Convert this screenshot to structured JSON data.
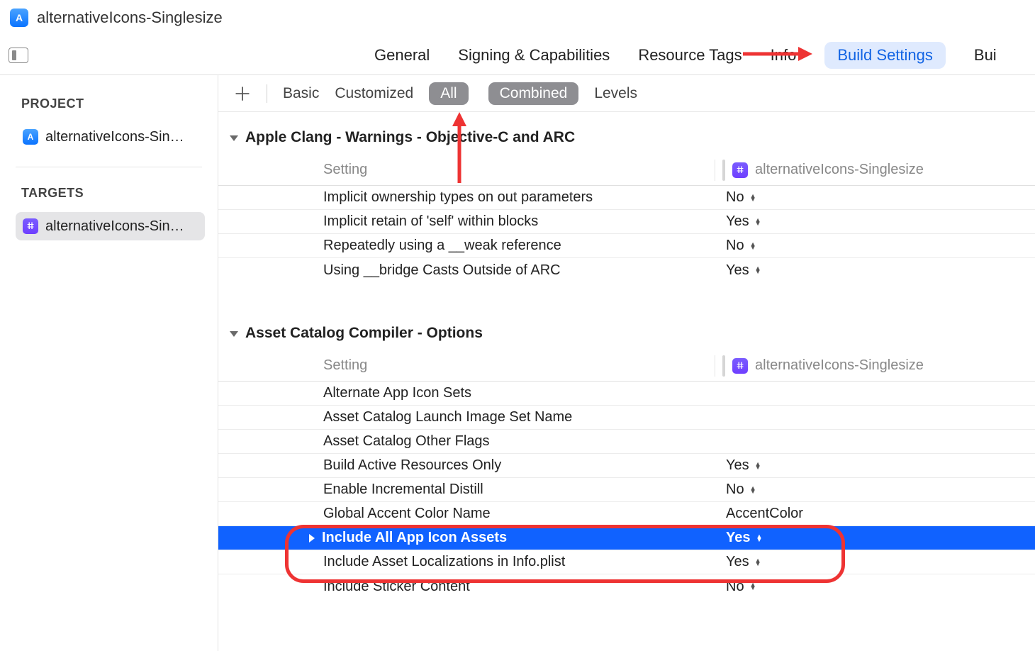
{
  "title": "alternativeIcons-Singlesize",
  "tabs": {
    "general": "General",
    "signing": "Signing & Capabilities",
    "resource": "Resource Tags",
    "info": "Info",
    "build_settings": "Build Settings",
    "build_cut": "Bui"
  },
  "filters": {
    "basic": "Basic",
    "customized": "Customized",
    "all": "All",
    "combined": "Combined",
    "levels": "Levels"
  },
  "sidebar": {
    "project_h": "PROJECT",
    "project_item": "alternativeIcons-Sin…",
    "targets_h": "TARGETS",
    "target_item": "alternativeIcons-Sin…"
  },
  "columns": {
    "setting": "Setting",
    "target_name": "alternativeIcons-Singlesize"
  },
  "sections": [
    {
      "title": "Apple Clang - Warnings - Objective-C and ARC",
      "rows": [
        {
          "name": "Implicit ownership types on out parameters",
          "value": "No",
          "popup": true
        },
        {
          "name": "Implicit retain of 'self' within blocks",
          "value": "Yes",
          "popup": true
        },
        {
          "name": "Repeatedly using a __weak reference",
          "value": "No",
          "popup": true
        },
        {
          "name": "Using __bridge Casts Outside of ARC",
          "value": "Yes",
          "popup": true
        }
      ]
    },
    {
      "title": "Asset Catalog Compiler - Options",
      "rows": [
        {
          "name": "Alternate App Icon Sets",
          "value": "",
          "popup": false
        },
        {
          "name": "Asset Catalog Launch Image Set Name",
          "value": "",
          "popup": false
        },
        {
          "name": "Asset Catalog Other Flags",
          "value": "",
          "popup": false
        },
        {
          "name": "Build Active Resources Only",
          "value": "Yes",
          "popup": true
        },
        {
          "name": "Enable Incremental Distill",
          "value": "No",
          "popup": true
        },
        {
          "name": "Global Accent Color Name",
          "value": "AccentColor",
          "popup": false
        },
        {
          "name": "Include All App Icon Assets",
          "value": "Yes",
          "popup": true,
          "selected": true
        },
        {
          "name": "Include Asset Localizations in Info.plist",
          "value": "Yes",
          "popup": true
        },
        {
          "name": "Include Sticker Content",
          "value": "No",
          "popup": true
        }
      ]
    }
  ]
}
